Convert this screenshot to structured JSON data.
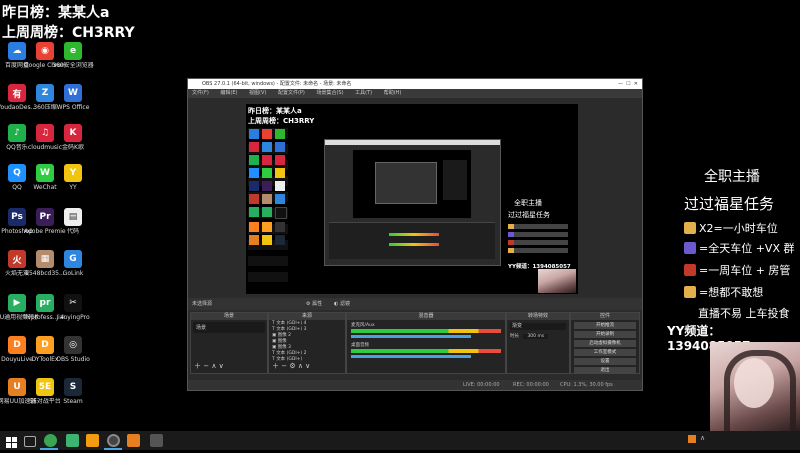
{
  "overlay": {
    "rank_yesterday": "昨日榜：某某人a",
    "rank_last_week": "上周周榜：CH3RRY",
    "right_title1": "全职主播",
    "right_title2": "过过福星任务",
    "right_lines": [
      {
        "text": "X2=一小时车位",
        "color": "#e3b04b"
      },
      {
        "text": "=全天车位 +VX 群",
        "color": "#6a5acd"
      },
      {
        "text": "=一周车位 + 房管",
        "color": "#c0392b"
      },
      {
        "text": "=想都不敢想",
        "color": "#e3b04b"
      }
    ],
    "right_note": "直播不易 上车投食",
    "right_yy": "YY频道：1394085057"
  },
  "desktop_icons": [
    {
      "label": "百度网盘",
      "color": "#2a7de1",
      "glyph": "☁"
    },
    {
      "label": "Google Chrome",
      "color": "#e94235",
      "glyph": "◉"
    },
    {
      "label": "360安全浏览器",
      "color": "#2eb82e",
      "glyph": "e"
    },
    {
      "label": "YoudaoDes...",
      "color": "#d7263d",
      "glyph": "有"
    },
    {
      "label": "360压缩",
      "color": "#2e86de",
      "glyph": "Z"
    },
    {
      "label": "WPS Office",
      "color": "#2f6fd6",
      "glyph": "W"
    },
    {
      "label": "QQ音乐",
      "color": "#21b14b",
      "glyph": "♪"
    },
    {
      "label": "cloudmusic",
      "color": "#d7263d",
      "glyph": "♫"
    },
    {
      "label": "金码K歌",
      "color": "#d7263d",
      "glyph": "K"
    },
    {
      "label": "QQ",
      "color": "#1e90ff",
      "glyph": "Q"
    },
    {
      "label": "WeChat",
      "color": "#2ecc40",
      "glyph": "W"
    },
    {
      "label": "YY",
      "color": "#f1c40f",
      "glyph": "Y"
    },
    {
      "label": "Photoshop",
      "color": "#1a2b6b",
      "glyph": "Ps"
    },
    {
      "label": "Adobe Premie...",
      "color": "#3b1d5a",
      "glyph": "Pr"
    },
    {
      "label": "代码",
      "color": "#eeeeee",
      "glyph": "▤"
    },
    {
      "label": "火焰无双",
      "color": "#c0392b",
      "glyph": "火"
    },
    {
      "label": "e548bcd35...",
      "color": "#b38b6d",
      "glyph": "▦"
    },
    {
      "label": "GoLink",
      "color": "#2e86de",
      "glyph": "G"
    },
    {
      "label": "EU通用视频转换器",
      "color": "#27ae60",
      "glyph": "▶"
    },
    {
      "label": "livprofess... 4.8",
      "color": "#27ae60",
      "glyph": "pr"
    },
    {
      "label": "JianyingPro",
      "color": "#111111",
      "glyph": "✂"
    },
    {
      "label": "DouyuLive",
      "color": "#ff7f1f",
      "glyph": "D"
    },
    {
      "label": "DYToolEx",
      "color": "#ff9f1f",
      "glyph": "D"
    },
    {
      "label": "OBS Studio",
      "color": "#333333",
      "glyph": "◎"
    },
    {
      "label": "网易UU加速器",
      "color": "#e67e22",
      "glyph": "U"
    },
    {
      "label": "5E对战平台",
      "color": "#f1c40f",
      "glyph": "5E"
    },
    {
      "label": "Steam",
      "color": "#1b2838",
      "glyph": "S"
    }
  ],
  "obs": {
    "title": "OBS 27.0.1 (64-bit, windows) - 配置文件: 未命名 - 场景: 未命名",
    "menu": [
      "文件(F)",
      "编辑(E)",
      "视图(V)",
      "配置文件(P)",
      "场景集合(S)",
      "工具(T)",
      "帮助(H)"
    ],
    "preview_right_line1": "全职主播",
    "preview_right_line2": "过过福星任务",
    "preview_yy": "YY频道：1394085057",
    "scene_label": "未选择源",
    "properties_label": "属性",
    "filters_label": "滤镜",
    "docks": {
      "scenes": "场景",
      "scene_item": "场景",
      "sources": "来源",
      "source_items": [
        "文本 (GDI+) 4",
        "文本 (GDI+) 3",
        "图像 2",
        "图像",
        "图像 3",
        "文本 (GDI+) 2",
        "文本 (GDI+)"
      ],
      "mixer": "混音器",
      "mixer_items": [
        "麦克风/Aux",
        "桌面音频"
      ],
      "transitions": "转场特效",
      "transition_value": "渐变",
      "duration_label": "时长",
      "duration_value": "300 ms",
      "controls": "控件",
      "control_buttons": [
        "开始推流",
        "开始录制",
        "启动虚拟摄像机",
        "工作室模式",
        "设置",
        "退出"
      ]
    },
    "status": {
      "live": "LIVE: 00:00:00",
      "rec": "REC: 00:00:00",
      "cpu": "CPU: 1.3%, 30.00 fps"
    }
  },
  "taskbar_icons": [
    "windows-start-icon",
    "task-view-icon",
    "obs-taskbar-icon",
    "douyu-taskbar-icon",
    "app-taskbar-icon",
    "media-taskbar-icon"
  ]
}
